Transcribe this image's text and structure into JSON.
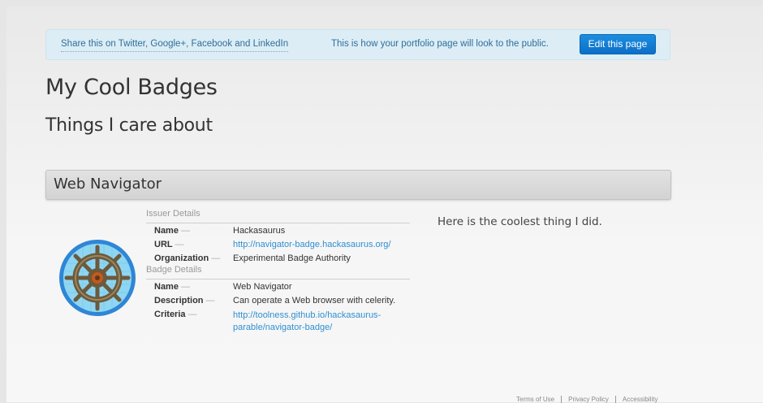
{
  "banner": {
    "share_text": "Share this on Twitter, Google+, Facebook and LinkedIn",
    "public_note": "This is how your portfolio page will look to the public.",
    "edit_button": "Edit this page"
  },
  "portfolio": {
    "title": "My Cool Badges",
    "subtitle": "Things I care about"
  },
  "badge": {
    "title": "Web Navigator",
    "image_icon": "ship-wheel-badge-icon",
    "issuer_section": "Issuer Details",
    "issuer": [
      {
        "label": "Name",
        "value": "Hackasaurus"
      },
      {
        "label": "URL",
        "value": "http://navigator-badge.hackasaurus.org/"
      },
      {
        "label": "Organization",
        "value": "Experimental Badge Authority"
      }
    ],
    "badge_section": "Badge Details",
    "details": [
      {
        "label": "Name",
        "value": "Web Navigator"
      },
      {
        "label": "Description",
        "value": "Can operate a Web browser with celerity."
      },
      {
        "label": "Criteria",
        "value": "http://toolness.github.io/hackasaurus-parable/navigator-badge/"
      }
    ],
    "dash": "—",
    "evidence_text": "Here is the coolest thing I did."
  },
  "footer": {
    "links": [
      "Terms of Use",
      "Privacy Policy",
      "Accessibility"
    ]
  },
  "colors": {
    "link": "#2f8fcf",
    "button": "#0c6fc7",
    "banner": "#dcedf5"
  }
}
